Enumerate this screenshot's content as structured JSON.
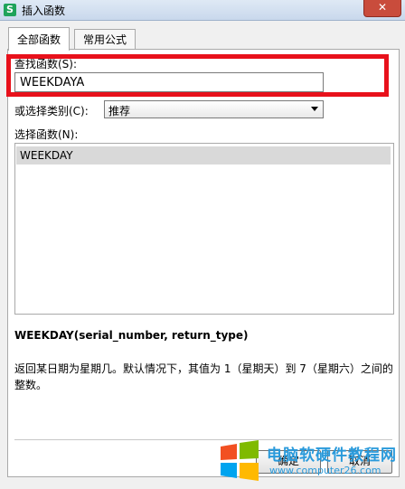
{
  "window": {
    "title": "插入函数",
    "app_icon_glyph": "S",
    "close_glyph": "✕"
  },
  "tabs": [
    {
      "label": "全部函数",
      "active": true
    },
    {
      "label": "常用公式",
      "active": false
    }
  ],
  "search": {
    "label": "查找函数(S):",
    "value": "WEEKDAYA"
  },
  "category": {
    "label": "或选择类别(C):",
    "selected": "推荐"
  },
  "functions": {
    "label": "选择函数(N):",
    "items": [
      "WEEKDAY"
    ]
  },
  "signature": "WEEKDAY(serial_number, return_type)",
  "description": "返回某日期为星期几。默认情况下，其值为 1（星期天）到 7（星期六）之间的整数。",
  "buttons": {
    "ok": "确定",
    "cancel": "取消"
  },
  "watermark": {
    "text": "电脑软硬件教程网",
    "url": "www.computer26.com"
  },
  "colors": {
    "highlight_box": "#e8111b",
    "watermark": "#2a9adb",
    "selected_row": "#d9d9d9"
  }
}
